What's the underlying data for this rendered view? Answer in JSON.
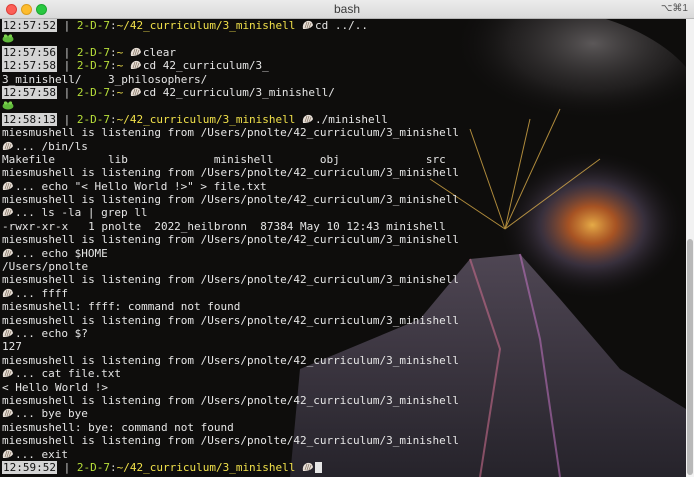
{
  "window": {
    "title": "bash",
    "shortcut": "⌥⌘1"
  },
  "prompt": {
    "user_host": "2-D-7",
    "path_home": "~",
    "path_42": "~/42_curriculum/3_minishell"
  },
  "lines": [
    {
      "kind": "prompt",
      "time": "12:57:52",
      "path": "~/42_curriculum/3_minishell",
      "cmd": "cd ../.."
    },
    {
      "kind": "frog"
    },
    {
      "kind": "prompt",
      "time": "12:57:56",
      "path": "~",
      "cmd": "clear"
    },
    {
      "kind": "prompt",
      "time": "12:57:58",
      "path": "~",
      "cmd": "cd 42_curriculum/3_"
    },
    {
      "kind": "text",
      "text": "3_minishell/    3_philosophers/"
    },
    {
      "kind": "prompt",
      "time": "12:57:58",
      "path": "~",
      "cmd": "cd 42_curriculum/3_minishell/"
    },
    {
      "kind": "frog"
    },
    {
      "kind": "prompt",
      "time": "12:58:13",
      "path": "~/42_curriculum/3_minishell",
      "cmd": "./minishell"
    },
    {
      "kind": "text",
      "text": "miesmushell is listening from /Users/pnolte/42_curriculum/3_minishell"
    },
    {
      "kind": "shell",
      "cmd": "... /bin/ls"
    },
    {
      "kind": "text",
      "text": "Makefile        lib             minishell       obj             src"
    },
    {
      "kind": "text",
      "text": "miesmushell is listening from /Users/pnolte/42_curriculum/3_minishell"
    },
    {
      "kind": "shell",
      "cmd": "... echo \"< Hello World !>\" > file.txt"
    },
    {
      "kind": "text",
      "text": "miesmushell is listening from /Users/pnolte/42_curriculum/3_minishell"
    },
    {
      "kind": "shell",
      "cmd": "... ls -la | grep ll"
    },
    {
      "kind": "text",
      "text": "-rwxr-xr-x   1 pnolte  2022_heilbronn  87384 May 10 12:43 minishell"
    },
    {
      "kind": "text",
      "text": "miesmushell is listening from /Users/pnolte/42_curriculum/3_minishell"
    },
    {
      "kind": "shell",
      "cmd": "... echo $HOME"
    },
    {
      "kind": "text",
      "text": "/Users/pnolte"
    },
    {
      "kind": "text",
      "text": "miesmushell is listening from /Users/pnolte/42_curriculum/3_minishell"
    },
    {
      "kind": "shell",
      "cmd": "... ffff"
    },
    {
      "kind": "text",
      "text": "miesmushell: ffff: command not found"
    },
    {
      "kind": "text",
      "text": "miesmushell is listening from /Users/pnolte/42_curriculum/3_minishell"
    },
    {
      "kind": "shell",
      "cmd": "... echo $?"
    },
    {
      "kind": "text",
      "text": "127"
    },
    {
      "kind": "text",
      "text": "miesmushell is listening from /Users/pnolte/42_curriculum/3_minishell"
    },
    {
      "kind": "shell",
      "cmd": "... cat file.txt"
    },
    {
      "kind": "text",
      "text": "< Hello World !>"
    },
    {
      "kind": "text",
      "text": "miesmushell is listening from /Users/pnolte/42_curriculum/3_minishell"
    },
    {
      "kind": "shell",
      "cmd": "... bye bye"
    },
    {
      "kind": "text",
      "text": "miesmushell: bye: command not found"
    },
    {
      "kind": "text",
      "text": "miesmushell is listening from /Users/pnolte/42_curriculum/3_minishell"
    },
    {
      "kind": "shell",
      "cmd": "... exit"
    },
    {
      "kind": "prompt",
      "time": "12:59:52",
      "path": "~/42_curriculum/3_minishell",
      "cmd": "",
      "cursor": true
    }
  ],
  "colors": {
    "user": "#b7df3a",
    "path": "#f0e04a",
    "timestamp_bg": "#d4d4d4",
    "text": "#e6e6e6",
    "background": "#0e0d0c"
  },
  "icons": {
    "prompt_glyph": "shell-icon",
    "frog_glyph": "frog-icon"
  }
}
